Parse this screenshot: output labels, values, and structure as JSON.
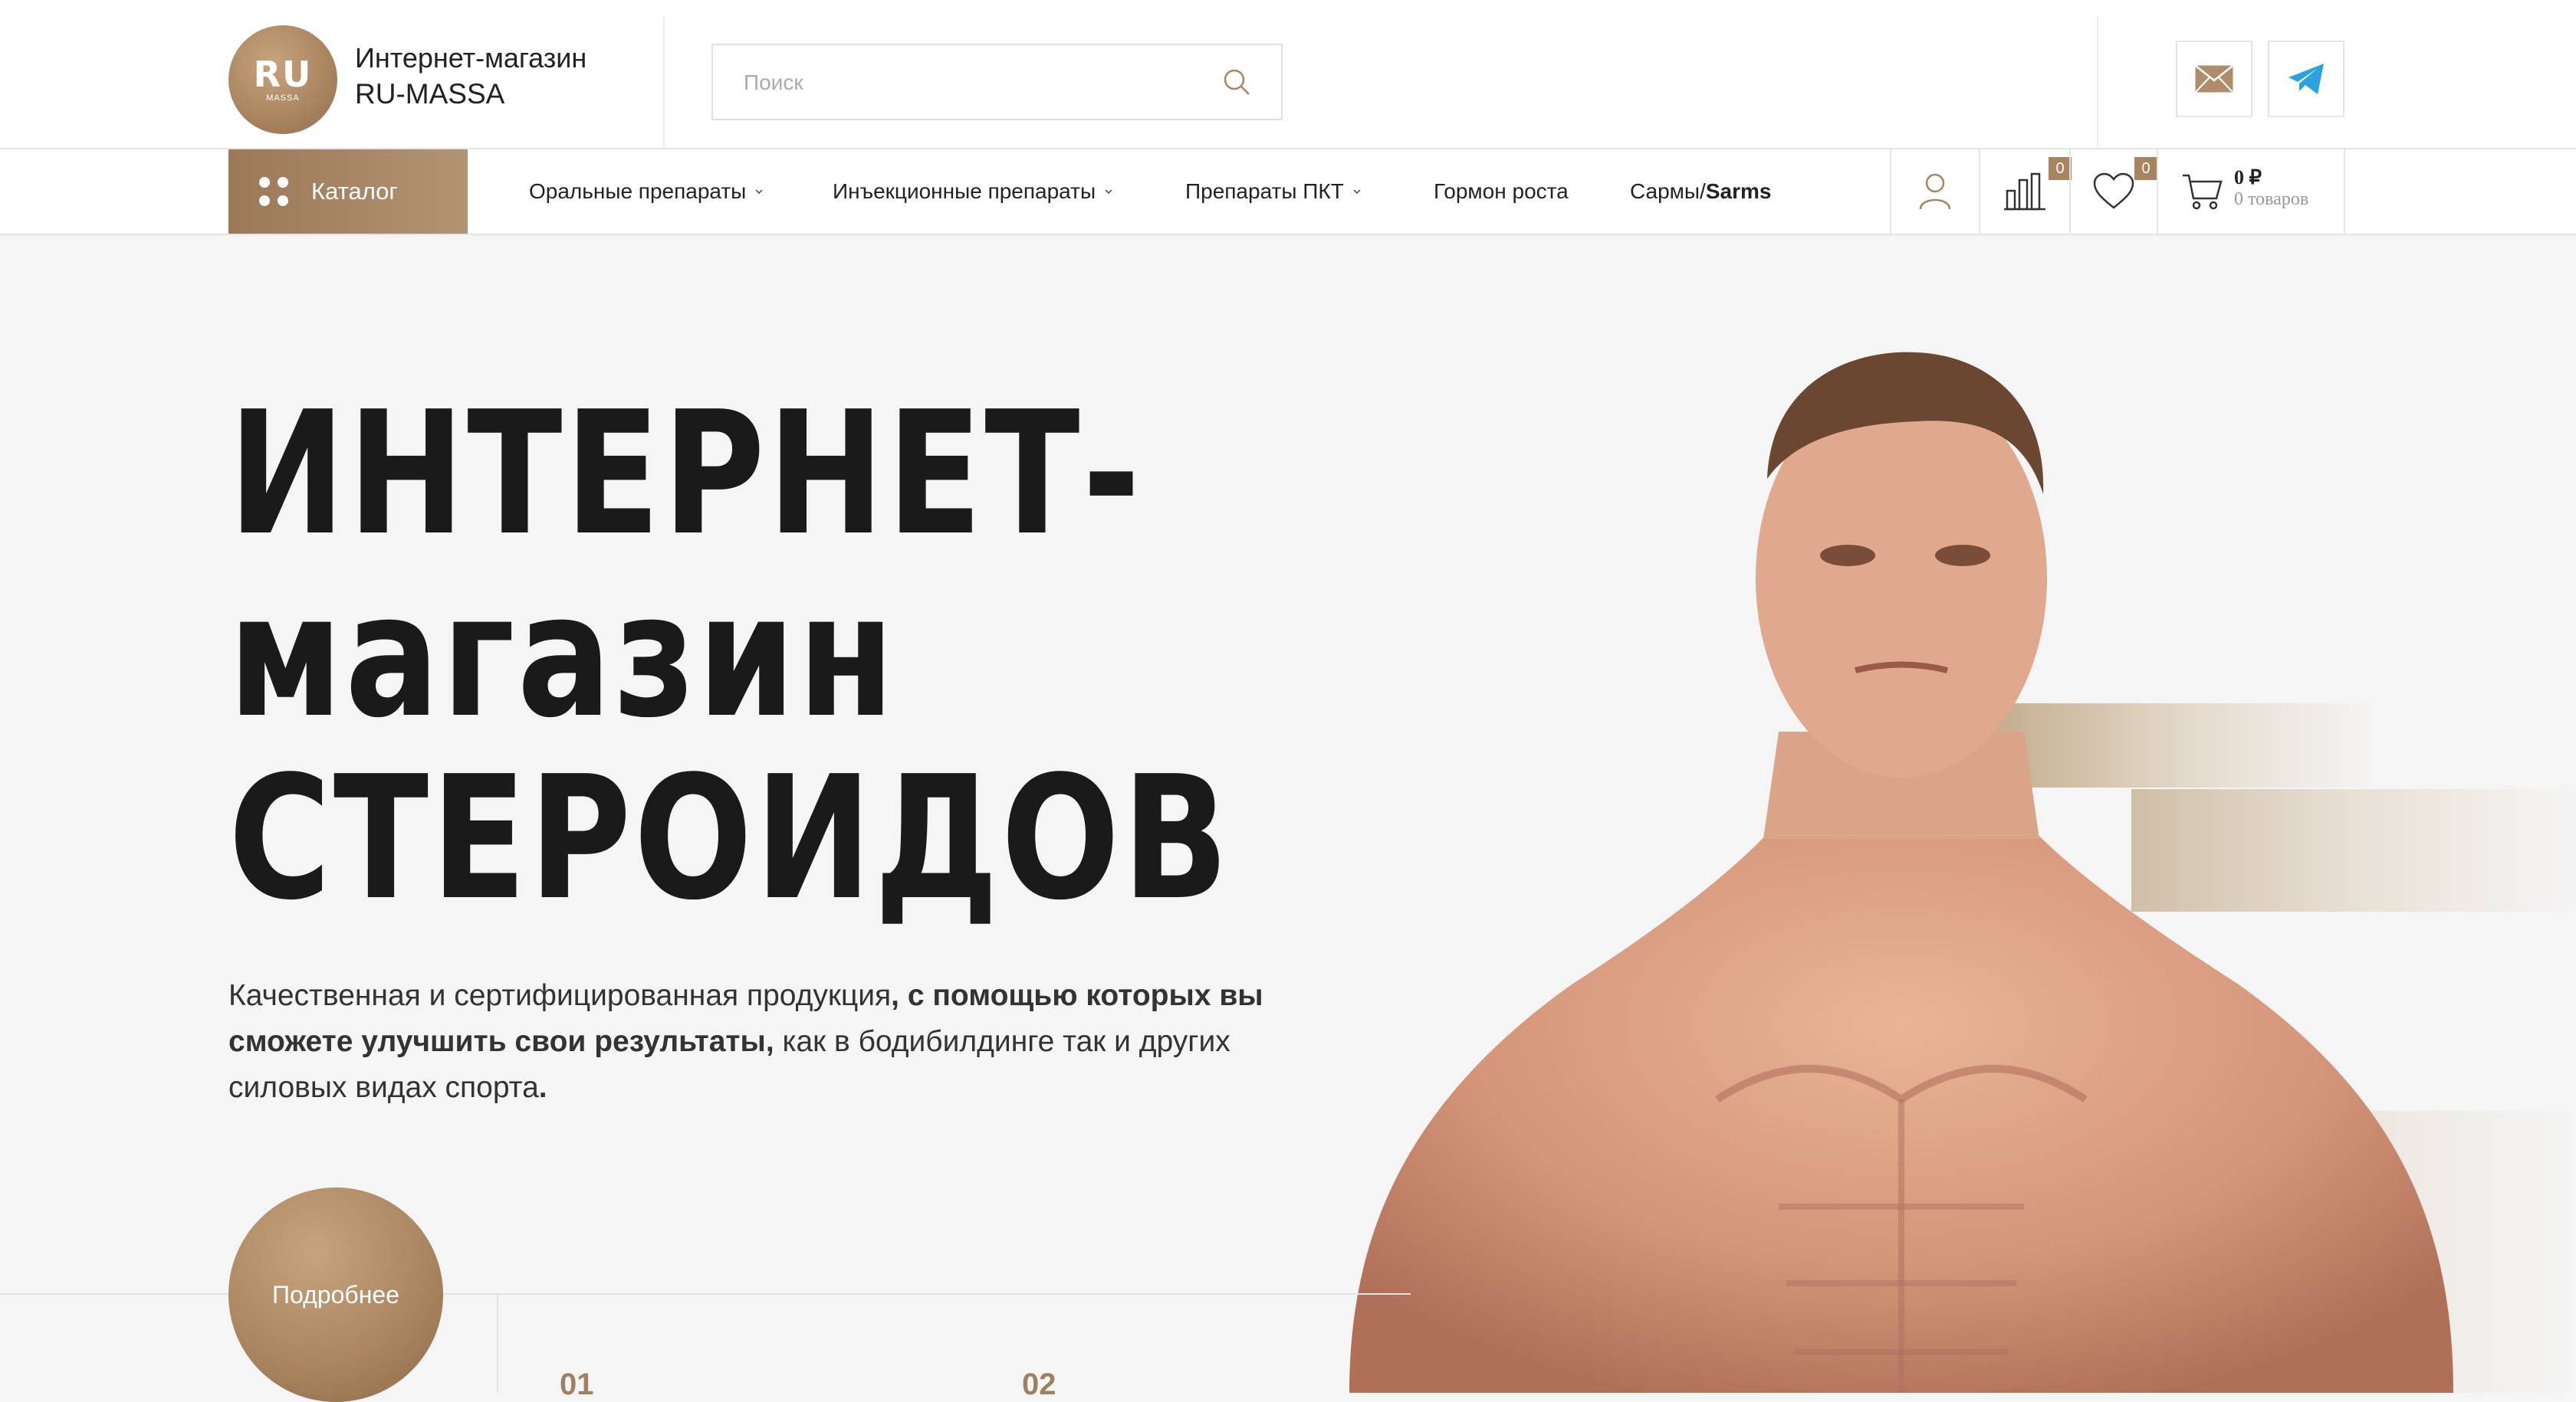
{
  "brand": {
    "logo_text": "RU",
    "logo_sub": "MASSA",
    "name_line1": "Интернет-магазин",
    "name_line2": "RU-MASSA"
  },
  "search": {
    "placeholder": "Поиск"
  },
  "icons": {
    "mail": "mail-icon",
    "telegram": "telegram-icon",
    "user": "user-icon",
    "compare": "compare-icon",
    "wishlist": "heart-icon",
    "cart": "cart-icon"
  },
  "nav": {
    "catalog_label": "Каталог",
    "items": [
      {
        "label": "Оральные препараты",
        "dropdown": true
      },
      {
        "label": "Инъекционные препараты",
        "dropdown": true
      },
      {
        "label": "Препараты ПКТ",
        "dropdown": true
      },
      {
        "label": "Гормон роста",
        "dropdown": false
      },
      {
        "label": "Сармы/",
        "bold_suffix": "Sarms",
        "dropdown": false
      }
    ]
  },
  "counters": {
    "compare": "0",
    "wishlist": "0",
    "cart_sum": "0 ₽",
    "cart_items": "0 товаров"
  },
  "hero": {
    "title_line1": "ИНТЕРНЕТ-",
    "title_line2": "магазин",
    "title_line3": "СТЕРОИДОВ",
    "text_part1": "Качественная и сертифицированная продукция",
    "text_bold1": ", с помощью которых вы сможете улучшить свои результаты,",
    "text_part2": " как в бодибилдинге так и других силовых видах спорта",
    "text_end": ".",
    "button_label": "Подробнее"
  },
  "steps": [
    "01",
    "02"
  ],
  "colors": {
    "accent": "#a9845f",
    "telegram": "#2aa3e0"
  }
}
